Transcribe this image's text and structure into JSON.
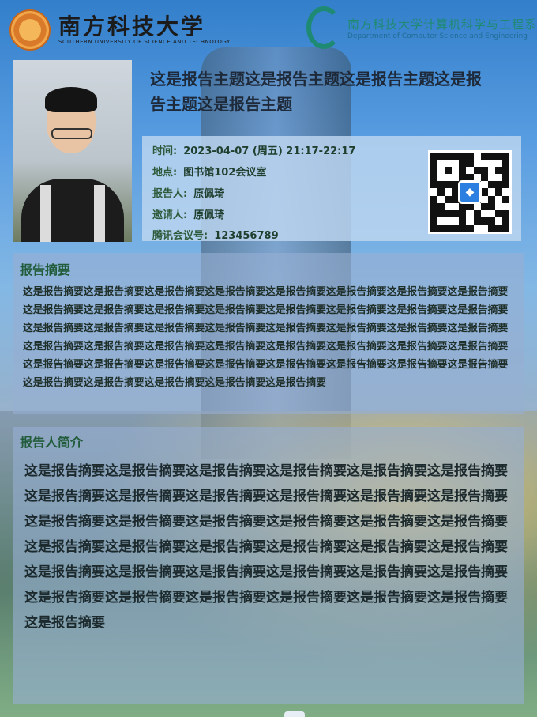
{
  "header": {
    "left_logo_cn": "南方科技大学",
    "left_logo_en": "SOUTHERN UNIVERSITY OF SCIENCE AND TECHNOLOGY",
    "right_logo_cn": "南方科技大学计算机科学与工程系",
    "right_logo_en": "Department of Computer Science and Engineering"
  },
  "title": "这是报告主题这是报告主题这是报告主题这是报告主题这是报告主题",
  "info": {
    "time_label": "时间:",
    "time_value": "2023-04-07 (周五) 21:17-22:17",
    "place_label": "地点:",
    "place_value": "图书馆102会议室",
    "speaker_label": "报告人:",
    "speaker_value": "原佩琦",
    "host_label": "邀请人:",
    "host_value": "原佩琦",
    "meeting_label": "腾讯会议号:",
    "meeting_value": "123456789"
  },
  "abstract": {
    "heading": "报告摘要",
    "text": "这是报告摘要这是报告摘要这是报告摘要这是报告摘要这是报告摘要这是报告摘要这是报告摘要这是报告摘要这是报告摘要这是报告摘要这是报告摘要这是报告摘要这是报告摘要这是报告摘要这是报告摘要这是报告摘要这是报告摘要这是报告摘要这是报告摘要这是报告摘要这是报告摘要这是报告摘要这是报告摘要这是报告摘要这是报告摘要这是报告摘要这是报告摘要这是报告摘要这是报告摘要这是报告摘要这是报告摘要这是报告摘要这是报告摘要这是报告摘要这是报告摘要这是报告摘要这是报告摘要这是报告摘要这是报告摘要这是报告摘要这是报告摘要这是报告摘要这是报告摘要这是报告摘要这是报告摘要"
  },
  "bio": {
    "heading": "报告人简介",
    "text": "这是报告摘要这是报告摘要这是报告摘要这是报告摘要这是报告摘要这是报告摘要这是报告摘要这是报告摘要这是报告摘要这是报告摘要这是报告摘要这是报告摘要这是报告摘要这是报告摘要这是报告摘要这是报告摘要这是报告摘要这是报告摘要这是报告摘要这是报告摘要这是报告摘要这是报告摘要这是报告摘要这是报告摘要这是报告摘要这是报告摘要这是报告摘要这是报告摘要这是报告摘要这是报告摘要这是报告摘要这是报告摘要这是报告摘要这是报告摘要这是报告摘要这是报告摘要这是报告摘要"
  },
  "icons": {
    "qr_logo": "tencent-meeting-icon",
    "speaker_photo": "speaker-photo"
  },
  "colors": {
    "heading_green": "#215c3a",
    "dept_teal": "#1f8a74"
  }
}
